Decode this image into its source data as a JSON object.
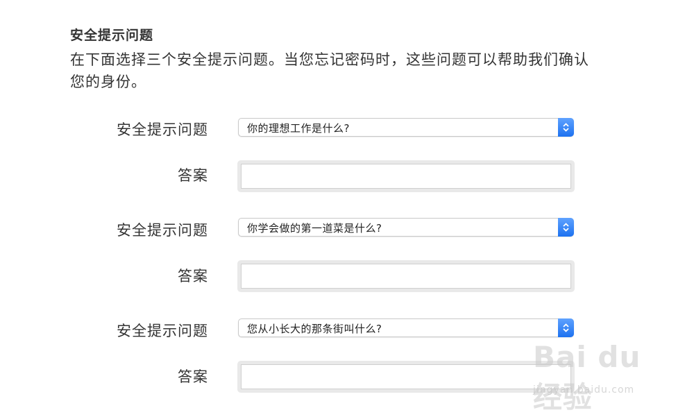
{
  "section": {
    "title": "安全提示问题",
    "description": "在下面选择三个安全提示问题。当您忘记密码时，这些问题可以帮助我们确认您的身份。"
  },
  "questions": [
    {
      "label": "安全提示问题",
      "selected": "你的理想工作是什么?",
      "answer_label": "答案",
      "answer_value": ""
    },
    {
      "label": "安全提示问题",
      "selected": "你学会做的第一道菜是什么?",
      "answer_label": "答案",
      "answer_value": ""
    },
    {
      "label": "安全提示问题",
      "selected": "您从小长大的那条街叫什么?",
      "answer_label": "答案",
      "answer_value": ""
    }
  ],
  "watermark": {
    "brand": "Bai du 经验",
    "url": "jingyan.baidu.com"
  },
  "colors": {
    "accent": "#1d72f0",
    "text": "#333333"
  }
}
